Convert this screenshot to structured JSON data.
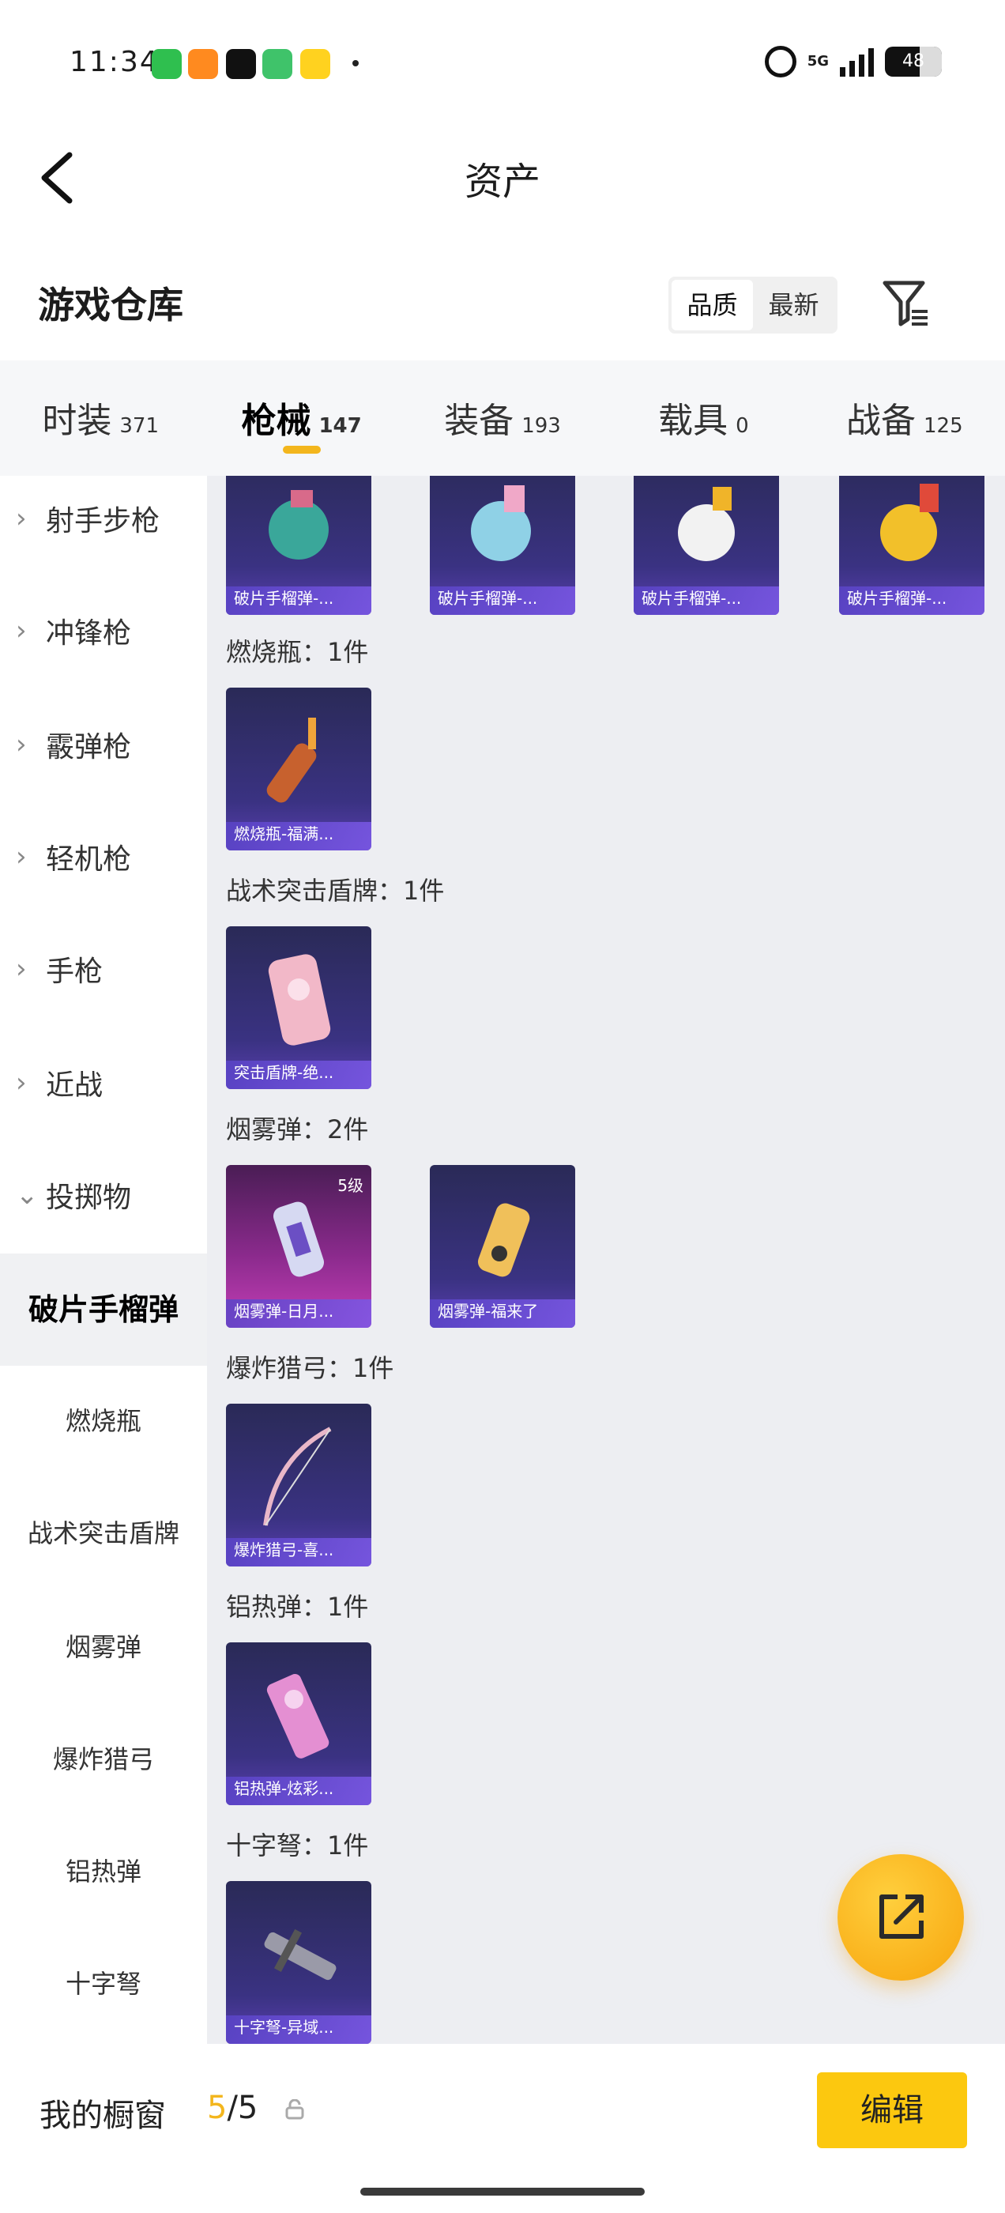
{
  "status_bar": {
    "time": "11:34",
    "network": "5G",
    "battery": "48"
  },
  "header": {
    "title": "资产"
  },
  "subheader": {
    "title": "游戏仓库",
    "sort_options": [
      "品质",
      "最新"
    ]
  },
  "tabs": [
    {
      "label": "时装",
      "count": "371"
    },
    {
      "label": "枪械",
      "count": "147"
    },
    {
      "label": "装备",
      "count": "193"
    },
    {
      "label": "载具",
      "count": "0"
    },
    {
      "label": "战备",
      "count": "125"
    }
  ],
  "sidebar": {
    "categories": [
      "射手步枪",
      "冲锋枪",
      "霰弹枪",
      "轻机枪",
      "手枪",
      "近战",
      "投掷物"
    ],
    "subcategories": [
      "破片手榴弹",
      "燃烧瓶",
      "战术突击盾牌",
      "烟雾弹",
      "爆炸猎弓",
      "铝热弹",
      "十字弩"
    ]
  },
  "content": {
    "top_row": [
      "破片手榴弹-...",
      "破片手榴弹-...",
      "破片手榴弹-...",
      "破片手榴弹-..."
    ],
    "groups": [
      {
        "label": "燃烧瓶：1件",
        "items": [
          "燃烧瓶-福满..."
        ]
      },
      {
        "label": "战术突击盾牌：1件",
        "items": [
          "突击盾牌-绝..."
        ]
      },
      {
        "label": "烟雾弹：2件",
        "items": [
          "烟雾弹-日月...",
          "烟雾弹-福来了"
        ],
        "tier": "5级"
      },
      {
        "label": "爆炸猎弓：1件",
        "items": [
          "爆炸猎弓-喜..."
        ]
      },
      {
        "label": "铝热弹：1件",
        "items": [
          "铝热弹-炫彩..."
        ]
      },
      {
        "label": "十字弩：1件",
        "items": [
          "十字弩-异域..."
        ]
      }
    ]
  },
  "bottom_bar": {
    "label": "我的橱窗",
    "used": "5",
    "total": "/5",
    "edit_label": "编辑"
  },
  "colors": {
    "accent": "#f3b61d",
    "edit_button": "#fcc80f",
    "card_bg": "#3a3282"
  }
}
